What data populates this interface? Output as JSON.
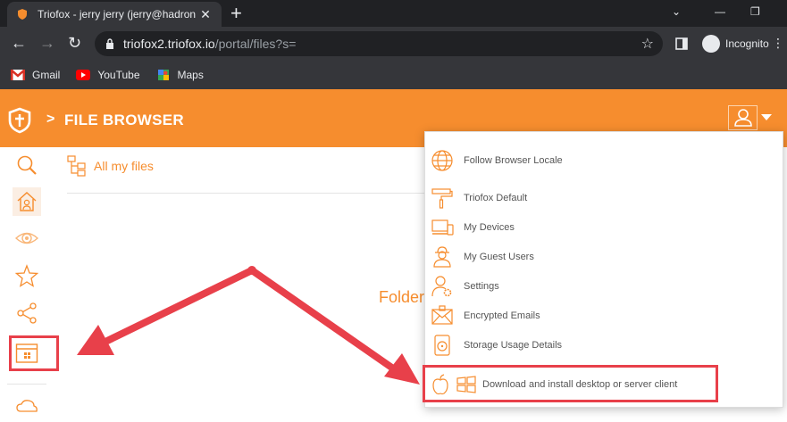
{
  "browser": {
    "tab_title": "Triofox - jerry jerry (jerry@hadron",
    "url_host": "triofox2.triofox.io",
    "url_path": "/portal/files?s=",
    "incognito_label": "Incognito",
    "bookmarks": [
      {
        "label": "Gmail",
        "icon": "gmail-icon"
      },
      {
        "label": "YouTube",
        "icon": "youtube-icon"
      },
      {
        "label": "Maps",
        "icon": "maps-icon"
      }
    ]
  },
  "header": {
    "separator": ">",
    "title": "FILE BROWSER"
  },
  "main": {
    "all_files_label": "All my files",
    "empty_text": "Folder"
  },
  "menu": {
    "items": [
      {
        "label": "Follow Browser Locale",
        "icon": "globe-icon"
      },
      {
        "label": "Triofox Default",
        "icon": "paint-roller-icon"
      },
      {
        "label": "My Devices",
        "icon": "devices-icon"
      },
      {
        "label": "My Guest Users",
        "icon": "guest-user-icon"
      },
      {
        "label": "Settings",
        "icon": "user-settings-icon"
      },
      {
        "label": "Encrypted Emails",
        "icon": "encrypted-email-icon"
      },
      {
        "label": "Storage Usage Details",
        "icon": "storage-icon"
      },
      {
        "label": "Download and install desktop or server client",
        "icon": "apple-windows-icon"
      }
    ]
  },
  "colors": {
    "accent": "#f68d2e",
    "annotation": "#e8404a",
    "chrome_dark": "#202124"
  }
}
